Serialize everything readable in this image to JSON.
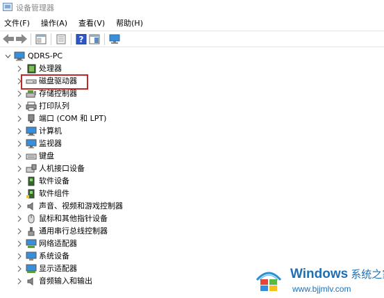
{
  "window": {
    "title": "设备管理器"
  },
  "menu": [
    {
      "label": "文件(F)"
    },
    {
      "label": "操作(A)"
    },
    {
      "label": "查看(V)"
    },
    {
      "label": "帮助(H)"
    }
  ],
  "toolbar": {
    "icons": [
      "back-arrow-icon",
      "forward-arrow-icon",
      "properties-icon",
      "update-driver-icon",
      "help-icon",
      "show-hide-icon",
      "monitor-scan-icon"
    ]
  },
  "tree": {
    "root": {
      "label": "QDRS-PC",
      "expanded": true
    },
    "items": [
      {
        "label": "处理器",
        "icon": "processor-icon"
      },
      {
        "label": "磁盘驱动器",
        "icon": "disk-drive-icon",
        "highlighted": true
      },
      {
        "label": "存储控制器",
        "icon": "storage-controller-icon"
      },
      {
        "label": "打印队列",
        "icon": "printer-icon"
      },
      {
        "label": "端口 (COM 和 LPT)",
        "icon": "port-icon"
      },
      {
        "label": "计算机",
        "icon": "computer-icon"
      },
      {
        "label": "监视器",
        "icon": "monitor-icon"
      },
      {
        "label": "键盘",
        "icon": "keyboard-icon"
      },
      {
        "label": "人机接口设备",
        "icon": "hid-icon"
      },
      {
        "label": "软件设备",
        "icon": "software-device-icon"
      },
      {
        "label": "软件组件",
        "icon": "software-component-icon"
      },
      {
        "label": "声音、视频和游戏控制器",
        "icon": "speaker-icon"
      },
      {
        "label": "鼠标和其他指针设备",
        "icon": "mouse-icon"
      },
      {
        "label": "通用串行总线控制器",
        "icon": "usb-icon"
      },
      {
        "label": "网络适配器",
        "icon": "network-adapter-icon"
      },
      {
        "label": "系统设备",
        "icon": "system-device-icon"
      },
      {
        "label": "显示适配器",
        "icon": "display-adapter-icon"
      },
      {
        "label": "音频输入和输出",
        "icon": "audio-io-icon"
      }
    ]
  },
  "watermark": {
    "brand": "Windows",
    "brand_cn": "系统之家",
    "url": "www.bjjmlv.com"
  }
}
